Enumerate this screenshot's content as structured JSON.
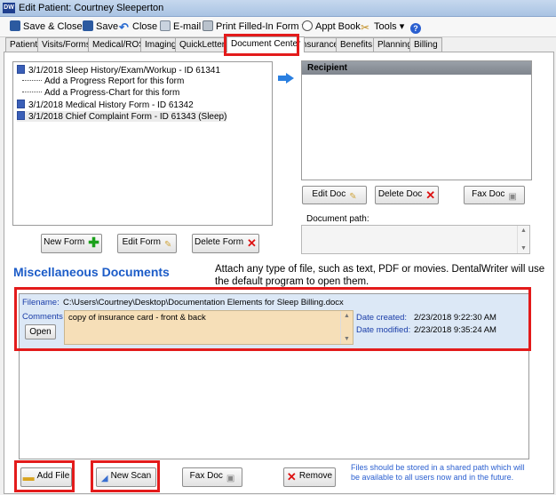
{
  "window": {
    "title": "Edit Patient: Courtney Sleeperton",
    "app_badge": "DW"
  },
  "toolbar": {
    "save_close": "Save & Close",
    "save": "Save",
    "close": "Close",
    "email": "E-mail",
    "print": "Print Filled-In Form ▾",
    "appt": "Appt Book",
    "tools": "Tools ▾"
  },
  "tabs": [
    {
      "label": "Patient"
    },
    {
      "label": "Visits/Forms"
    },
    {
      "label": "Medical/ROS"
    },
    {
      "label": "Imaging"
    },
    {
      "label": "QuickLetters"
    },
    {
      "label": "Document Center"
    },
    {
      "label": "Insurance"
    },
    {
      "label": "Benefits"
    },
    {
      "label": "Planning"
    },
    {
      "label": "Billing"
    }
  ],
  "forms": {
    "items": [
      {
        "label": "3/1/2018 Sleep History/Exam/Workup - ID 61341",
        "kind": "doc"
      },
      {
        "label": "Add a Progress Report for this form",
        "kind": "child"
      },
      {
        "label": "Add a Progress-Chart for this form",
        "kind": "child"
      },
      {
        "label": "3/1/2018 Medical History Form - ID 61342",
        "kind": "doc"
      },
      {
        "label": "3/1/2018 Chief Complaint Form - ID 61343 (Sleep)",
        "kind": "doc"
      }
    ],
    "new_form": "New Form",
    "edit_form": "Edit Form",
    "delete_form": "Delete Form"
  },
  "recipient": {
    "header": "Recipient",
    "edit_doc": "Edit Doc",
    "delete_doc": "Delete Doc",
    "fax_doc": "Fax Doc",
    "path_label": "Document path:",
    "path_value": ""
  },
  "misc": {
    "title": "Miscellaneous Documents",
    "description": "Attach any type of file, such as text, PDF or movies. DentalWriter will use the default program to open them.",
    "filename_label": "Filename:",
    "filename_value": "C:\\Users\\Courtney\\Desktop\\Documentation Elements for Sleep Billing.docx",
    "comments_label": "Comments",
    "comments_value": "copy of insurance card - front & back",
    "open": "Open",
    "date_created_label": "Date created:",
    "date_created_value": "2/23/2018 9:22:30 AM",
    "date_modified_label": "Date modified:",
    "date_modified_value": "2/23/2018 9:35:24 AM"
  },
  "bottom": {
    "add_file": "Add File",
    "new_scan": "New Scan",
    "fax_doc": "Fax Doc",
    "remove": "Remove",
    "note": "Files should be stored  in a shared path which will be available to all users now and in the future."
  },
  "colors": {
    "highlight": "#e31b1b",
    "section_blue": "#1c5cc8",
    "selected_row": "#dce8f6",
    "comment_bg": "#f6dfb8",
    "note_blue": "#2a5fd0"
  }
}
